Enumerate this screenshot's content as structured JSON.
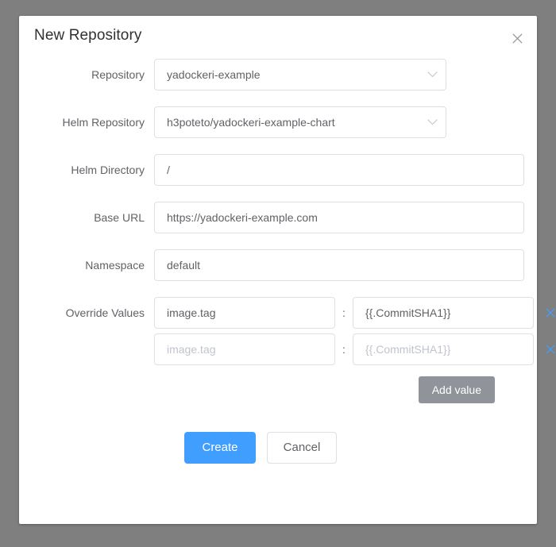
{
  "dialog": {
    "title": "New Repository",
    "close_icon": "close-icon"
  },
  "form": {
    "repository": {
      "label": "Repository",
      "value": "yadockeri-example",
      "control": "select",
      "chevron_icon": "chevron-down-icon"
    },
    "helm_repository": {
      "label": "Helm Repository",
      "value": "h3poteto/yadockeri-example-chart",
      "control": "select",
      "chevron_icon": "chevron-down-icon"
    },
    "helm_directory": {
      "label": "Helm Directory",
      "value": "/",
      "control": "text"
    },
    "base_url": {
      "label": "Base URL",
      "value": "https://yadockeri-example.com",
      "control": "text"
    },
    "namespace": {
      "label": "Namespace",
      "value": "default",
      "control": "text"
    },
    "override_values": {
      "label": "Override Values",
      "separator": ":",
      "remove_icon": "close-icon",
      "add_button": "Add value",
      "rows": [
        {
          "key": "image.tag",
          "key_placeholder": "image.tag",
          "value": "{{.CommitSHA1}}",
          "value_placeholder": "{{.CommitSHA1}}"
        },
        {
          "key": "",
          "key_placeholder": "image.tag",
          "value": "",
          "value_placeholder": "{{.CommitSHA1}}"
        }
      ]
    }
  },
  "footer": {
    "create_label": "Create",
    "cancel_label": "Cancel"
  },
  "colors": {
    "primary": "#409eff",
    "info": "#909399",
    "border": "#dcdfe6",
    "label_text": "#606266",
    "title_text": "#303133",
    "placeholder": "#c0c4cc",
    "overlay": "#7f7f7f"
  }
}
